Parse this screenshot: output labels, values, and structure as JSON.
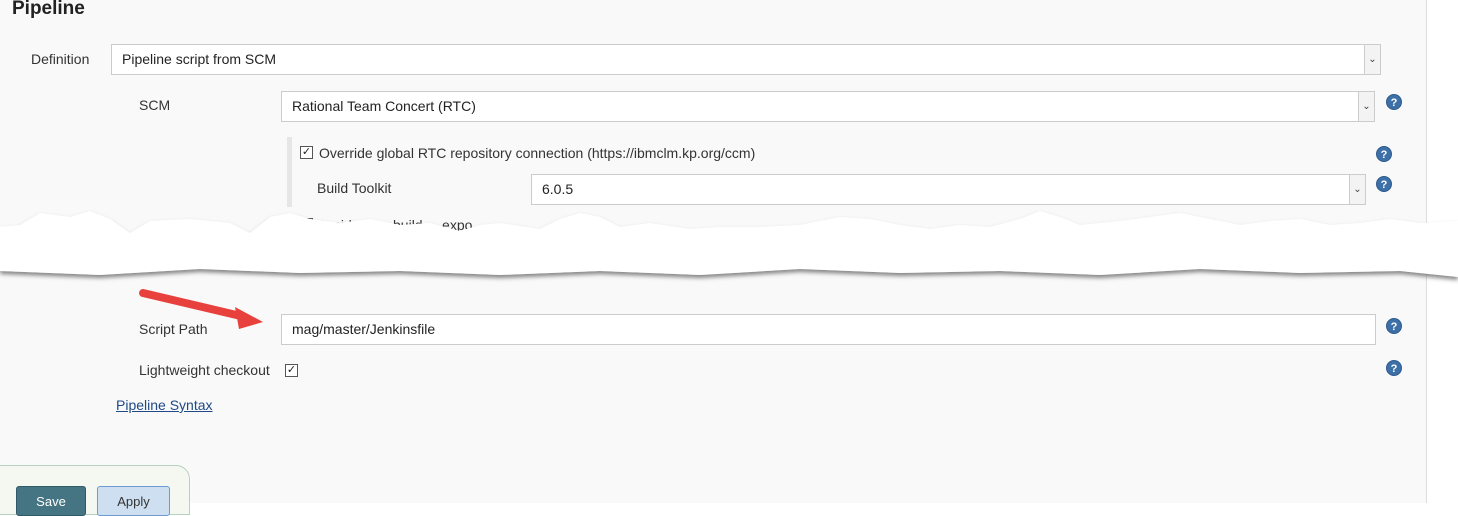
{
  "section_title": "Pipeline",
  "definition": {
    "label": "Definition",
    "value": "Pipeline script from SCM"
  },
  "scm": {
    "label": "SCM",
    "value": "Rational Team Concert (RTC)"
  },
  "override": {
    "label": "Override global RTC repository connection (https://ibmclm.kp.org/ccm)",
    "checked": true
  },
  "build_toolkit": {
    "label": "Build Toolkit",
    "value": "6.0.5"
  },
  "avoid_partial": {
    "label": "Avoid using build ... expo",
    "checked": false
  },
  "script_path": {
    "label": "Script Path",
    "value": "mag/master/Jenkinsfile"
  },
  "lightweight": {
    "label": "Lightweight checkout",
    "checked": true
  },
  "pipeline_syntax": "Pipeline Syntax",
  "buttons": {
    "save": "Save",
    "apply": "Apply"
  },
  "colors": {
    "save_bg": "#457583",
    "apply_bg": "#cddff0",
    "annotation_arrow": "#e8413d",
    "help": "#3d6fa8"
  }
}
